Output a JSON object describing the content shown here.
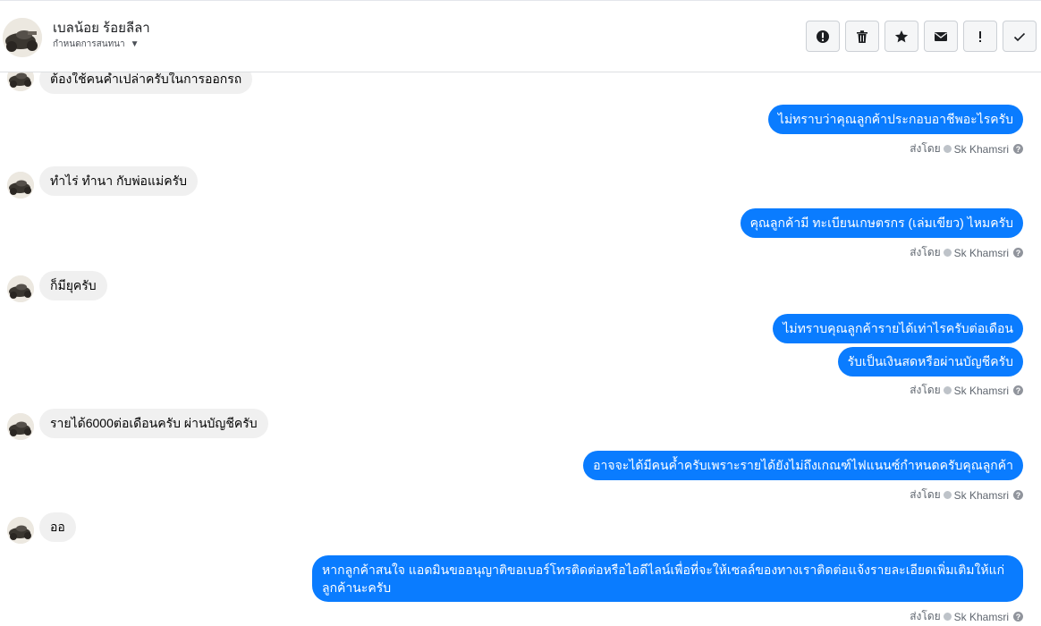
{
  "header": {
    "name": "เบลน้อย ร้อยลีลา",
    "subtitle": "กำหนดการสนทนา",
    "actions": [
      {
        "name": "spam-button",
        "icon": "alert-circle-icon"
      },
      {
        "name": "delete-button",
        "icon": "trash-icon"
      },
      {
        "name": "star-button",
        "icon": "star-icon"
      },
      {
        "name": "mark-unread-button",
        "icon": "envelope-icon"
      },
      {
        "name": "important-button",
        "icon": "exclamation-icon"
      },
      {
        "name": "done-button",
        "icon": "check-icon"
      }
    ]
  },
  "thread": {
    "sent_by_label": "ส่งโดย",
    "sender": "Sk Khamsri",
    "messages": [
      {
        "dir": "in",
        "text": "ต้องใช้คนค้ำเปล่าครับในการออกรถ"
      },
      {
        "dir": "out",
        "text": "ไม่ทราบว่าคุณลูกค้าประกอบอาชีพอะไรครับ"
      },
      {
        "dir": "in",
        "text": "ทำไร่  ทำนา กับพ่อแม่ครับ"
      },
      {
        "dir": "out",
        "text": "คุณลูกค้ามี ทะเบียนเกษตรกร (เล่มเขียว) ไหมครับ"
      },
      {
        "dir": "in",
        "text": "ก็มียุครับ"
      },
      {
        "dir": "out",
        "text": "ไม่ทราบคุณลูกค้ารายได้เท่าไรครับต่อเดือน"
      },
      {
        "dir": "out",
        "text": "รับเป็นเงินสดหรือผ่านบัญชีครับ"
      },
      {
        "dir": "in",
        "text": "รายได้6000ต่อเดือนครับ  ผ่านบัญชีครับ"
      },
      {
        "dir": "out",
        "text": "อาจจะได้มีคนค้ำครับเพราะรายได้ยังไม่ถึงเกณฑ์ไฟแนนซ์กำหนดครับคุณลูกค้า"
      },
      {
        "dir": "in",
        "text": "ออ"
      },
      {
        "dir": "out",
        "text": "หากลูกค้าสนใจ แอดมินขออนุญาติขอเบอร์โทรติดต่อหรือไอดีไลน์เพื่อที่จะให้เซลล์ของทางเราติดต่อแจ้งรายละเอียดเพิ่มเติมให้แก่ลูกค้านะครับ"
      }
    ]
  }
}
